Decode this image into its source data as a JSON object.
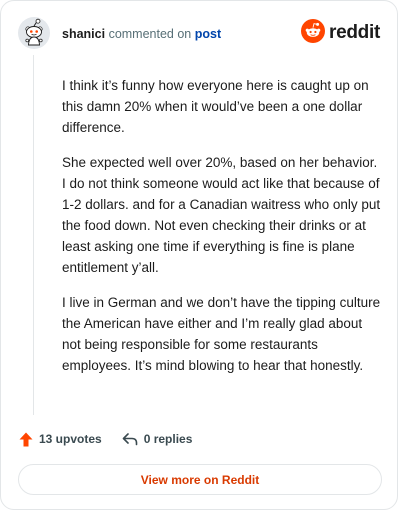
{
  "comment": {
    "username": "shanici",
    "verb": "commented on",
    "target": "post",
    "brand": "reddit",
    "paragraphs": [
      "I think it’s funny how everyone here is caught up on this damn 20% when it would’ve been a one dollar difference.",
      "She expected well over 20%, based on her behavior. I do not think someone would act like that because of 1-2 dollars. and for a Canadian waitress who only put the food down. Not even checking their drinks or at least asking one time if everything is fine is plane entitlement y’all.",
      "I live in German and we don’t have the tipping culture the American have either and I’m really glad about not being responsible for some restaurants employees. It’s mind blowing to hear that honestly."
    ]
  },
  "actions": {
    "upvotes": "13 upvotes",
    "replies": "0 replies"
  },
  "view_button": "View more on Reddit",
  "icons": {
    "avatar": "snoo-avatar-icon",
    "logo": "reddit-logo-icon",
    "upvote": "upvote-arrow-icon",
    "reply": "reply-arrow-icon"
  },
  "colors": {
    "brand_orange": "#ff4500",
    "link_blue": "#0045ac",
    "button_text": "#d93a00",
    "border": "#e3e6e8"
  }
}
